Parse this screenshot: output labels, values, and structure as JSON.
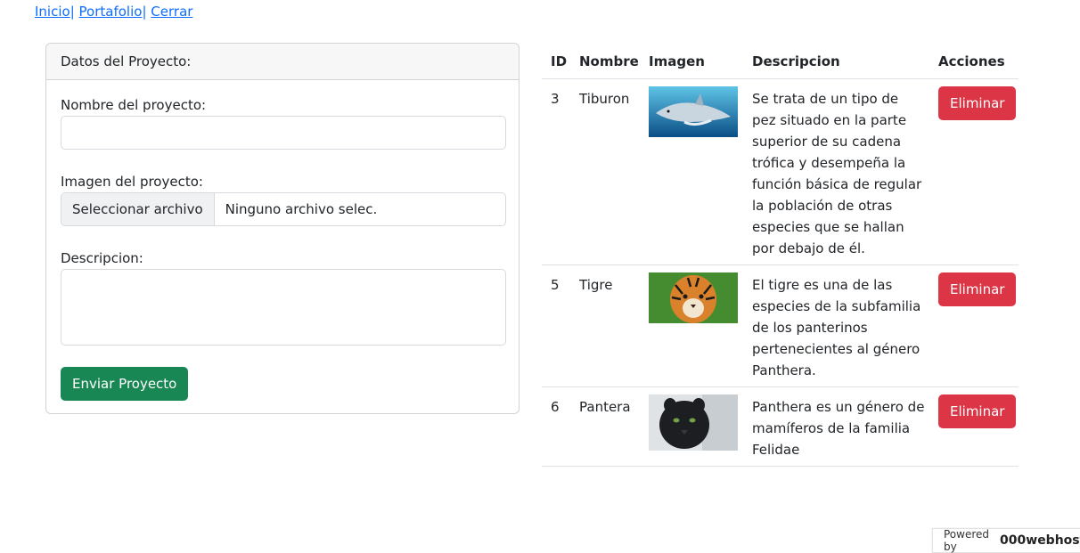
{
  "nav": {
    "items": [
      "Inicio",
      "Portafolio",
      "Cerrar"
    ],
    "separator": "|"
  },
  "form": {
    "header": "Datos del Proyecto:",
    "name_label": "Nombre del proyecto:",
    "name_value": "",
    "image_label": "Imagen del proyecto:",
    "file_button": "Seleccionar archivo",
    "file_status": "Ninguno archivo selec.",
    "desc_label": "Descripcion:",
    "desc_value": "",
    "submit": "Enviar Proyecto"
  },
  "table": {
    "headers": [
      "ID",
      "Nombre",
      "Imagen",
      "Descripcion",
      "Acciones"
    ],
    "rows": [
      {
        "id": "3",
        "name": "Tiburon",
        "image": "shark",
        "description": "Se trata de un tipo de pez situado en la parte superior de su cadena trófica y desempeña la función básica de regular la población de otras especies que se hallan por debajo de él.",
        "action": "Eliminar"
      },
      {
        "id": "5",
        "name": "Tigre",
        "image": "tiger",
        "description": "El tigre es una de las especies de la subfamilia de los panterinos pertenecientes al género Panthera.",
        "action": "Eliminar"
      },
      {
        "id": "6",
        "name": "Pantera",
        "image": "panther",
        "description": "Panthera es un género de mamíferos de la familia Felidae",
        "action": "Eliminar"
      }
    ]
  },
  "badge": {
    "prefix": "Powered by",
    "brand": "000webhost"
  },
  "colors": {
    "link": "#0d6efd",
    "success": "#198754",
    "danger": "#dc3545"
  }
}
